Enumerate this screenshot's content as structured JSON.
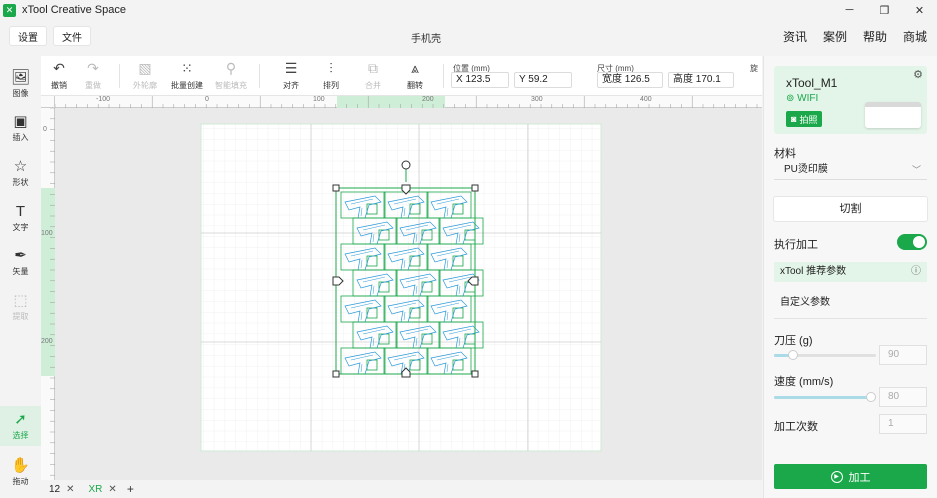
{
  "app": {
    "title": "xTool Creative Space",
    "logo": "xtool-logo-icon"
  },
  "window_controls": [
    "minimize-icon",
    "maximize-icon",
    "close-icon"
  ],
  "menu": {
    "settings": "设置",
    "file": "文件"
  },
  "document_title": "手机壳",
  "top_links": [
    "资讯",
    "案例",
    "帮助",
    "商城"
  ],
  "toolbar": {
    "undo": "撤销",
    "redo": "重做",
    "outline": "外轮廓",
    "batch_create": "批量创建",
    "smart_fill": "智能填充",
    "align": "对齐",
    "arrange": "排列",
    "combine": "合并",
    "flip": "翻转",
    "position_label": "位置 (mm)",
    "x_value": "X 123.5",
    "y_value": "Y 59.2",
    "size_label": "尺寸 (mm)",
    "width_value": "宽度 126.5",
    "height_value": "高度 170.1",
    "rotate_label_partial": "旋"
  },
  "sidebar": [
    {
      "label": "图像",
      "icon": "image-icon",
      "state": "normal"
    },
    {
      "label": "插入",
      "icon": "insert-icon",
      "state": "normal"
    },
    {
      "label": "形状",
      "icon": "shape-icon",
      "state": "normal"
    },
    {
      "label": "文字",
      "icon": "text-icon",
      "state": "normal"
    },
    {
      "label": "矢量",
      "icon": "vector-pen-icon",
      "state": "normal"
    },
    {
      "label": "提取",
      "icon": "extract-icon",
      "state": "disabled"
    },
    {
      "label": "选择",
      "icon": "select-cursor-icon",
      "state": "active"
    },
    {
      "label": "拖动",
      "icon": "hand-drag-icon",
      "state": "normal"
    }
  ],
  "rulers": {
    "top_ticks": [
      "-100",
      "0",
      "100",
      "200",
      "300",
      "400"
    ],
    "left_ticks": [
      "0",
      "100",
      "200"
    ]
  },
  "tabs": [
    {
      "name": "12",
      "active": false
    },
    {
      "name": "XR",
      "active": true
    }
  ],
  "right_panel": {
    "device_name": "xTool_M1",
    "connection": "WIFI",
    "snapshot_button": "拍照",
    "material_label": "材料",
    "material_value": "PU烫印膜",
    "mode_button": "切割",
    "execute_label": "执行加工",
    "execute_enabled": true,
    "recommended_params": "xTool 推荐参数",
    "custom_params": "自定义参数",
    "blade_pressure_label": "刀压 (g)",
    "blade_pressure_value": "90",
    "speed_label": "速度 (mm/s)",
    "speed_value": "80",
    "passes_label": "加工次数",
    "passes_value": "1",
    "process_button": "加工"
  },
  "colors": {
    "accent": "#1aa84a",
    "selection": "#1aa84a",
    "pattern": "#2a9ad8"
  }
}
